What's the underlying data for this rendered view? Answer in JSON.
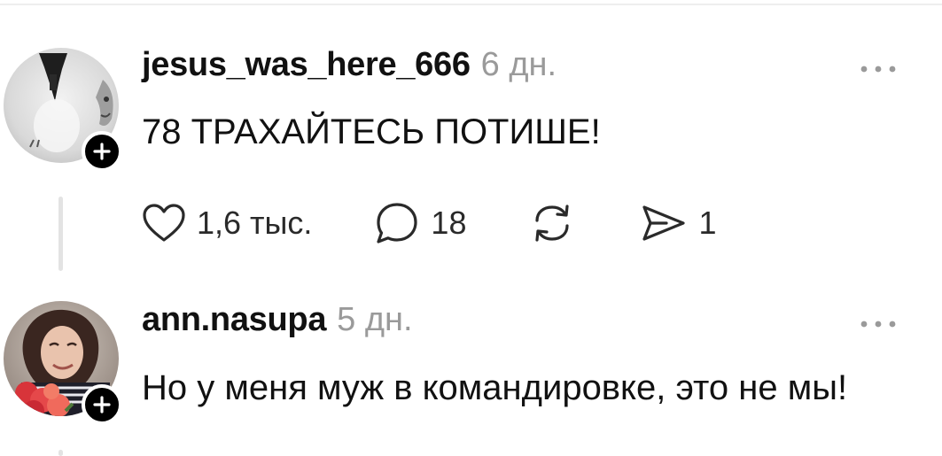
{
  "comments": [
    {
      "username": "jesus_was_here_666",
      "time": "6 дн.",
      "text": "78 ТРАХАЙТЕСЬ ПОТИШЕ!",
      "likes": "1,6 тыс.",
      "replies": "18",
      "reposts": "",
      "shares": "1",
      "avatar_icon": "avatar-image",
      "follow_icon": "plus-icon"
    },
    {
      "username": "ann.nasupa",
      "time": "5 дн.",
      "text": "Но у меня муж в командировке, это не мы!",
      "avatar_icon": "avatar-image",
      "follow_icon": "plus-icon"
    }
  ],
  "icons": {
    "like": "heart-icon",
    "reply": "comment-bubble-icon",
    "repost": "repost-icon",
    "share": "send-icon",
    "more": "more-horizontal-icon"
  },
  "colors": {
    "text": "#111111",
    "muted": "#9a9a9a",
    "divider": "#e3e3e3",
    "badge": "#000000"
  }
}
